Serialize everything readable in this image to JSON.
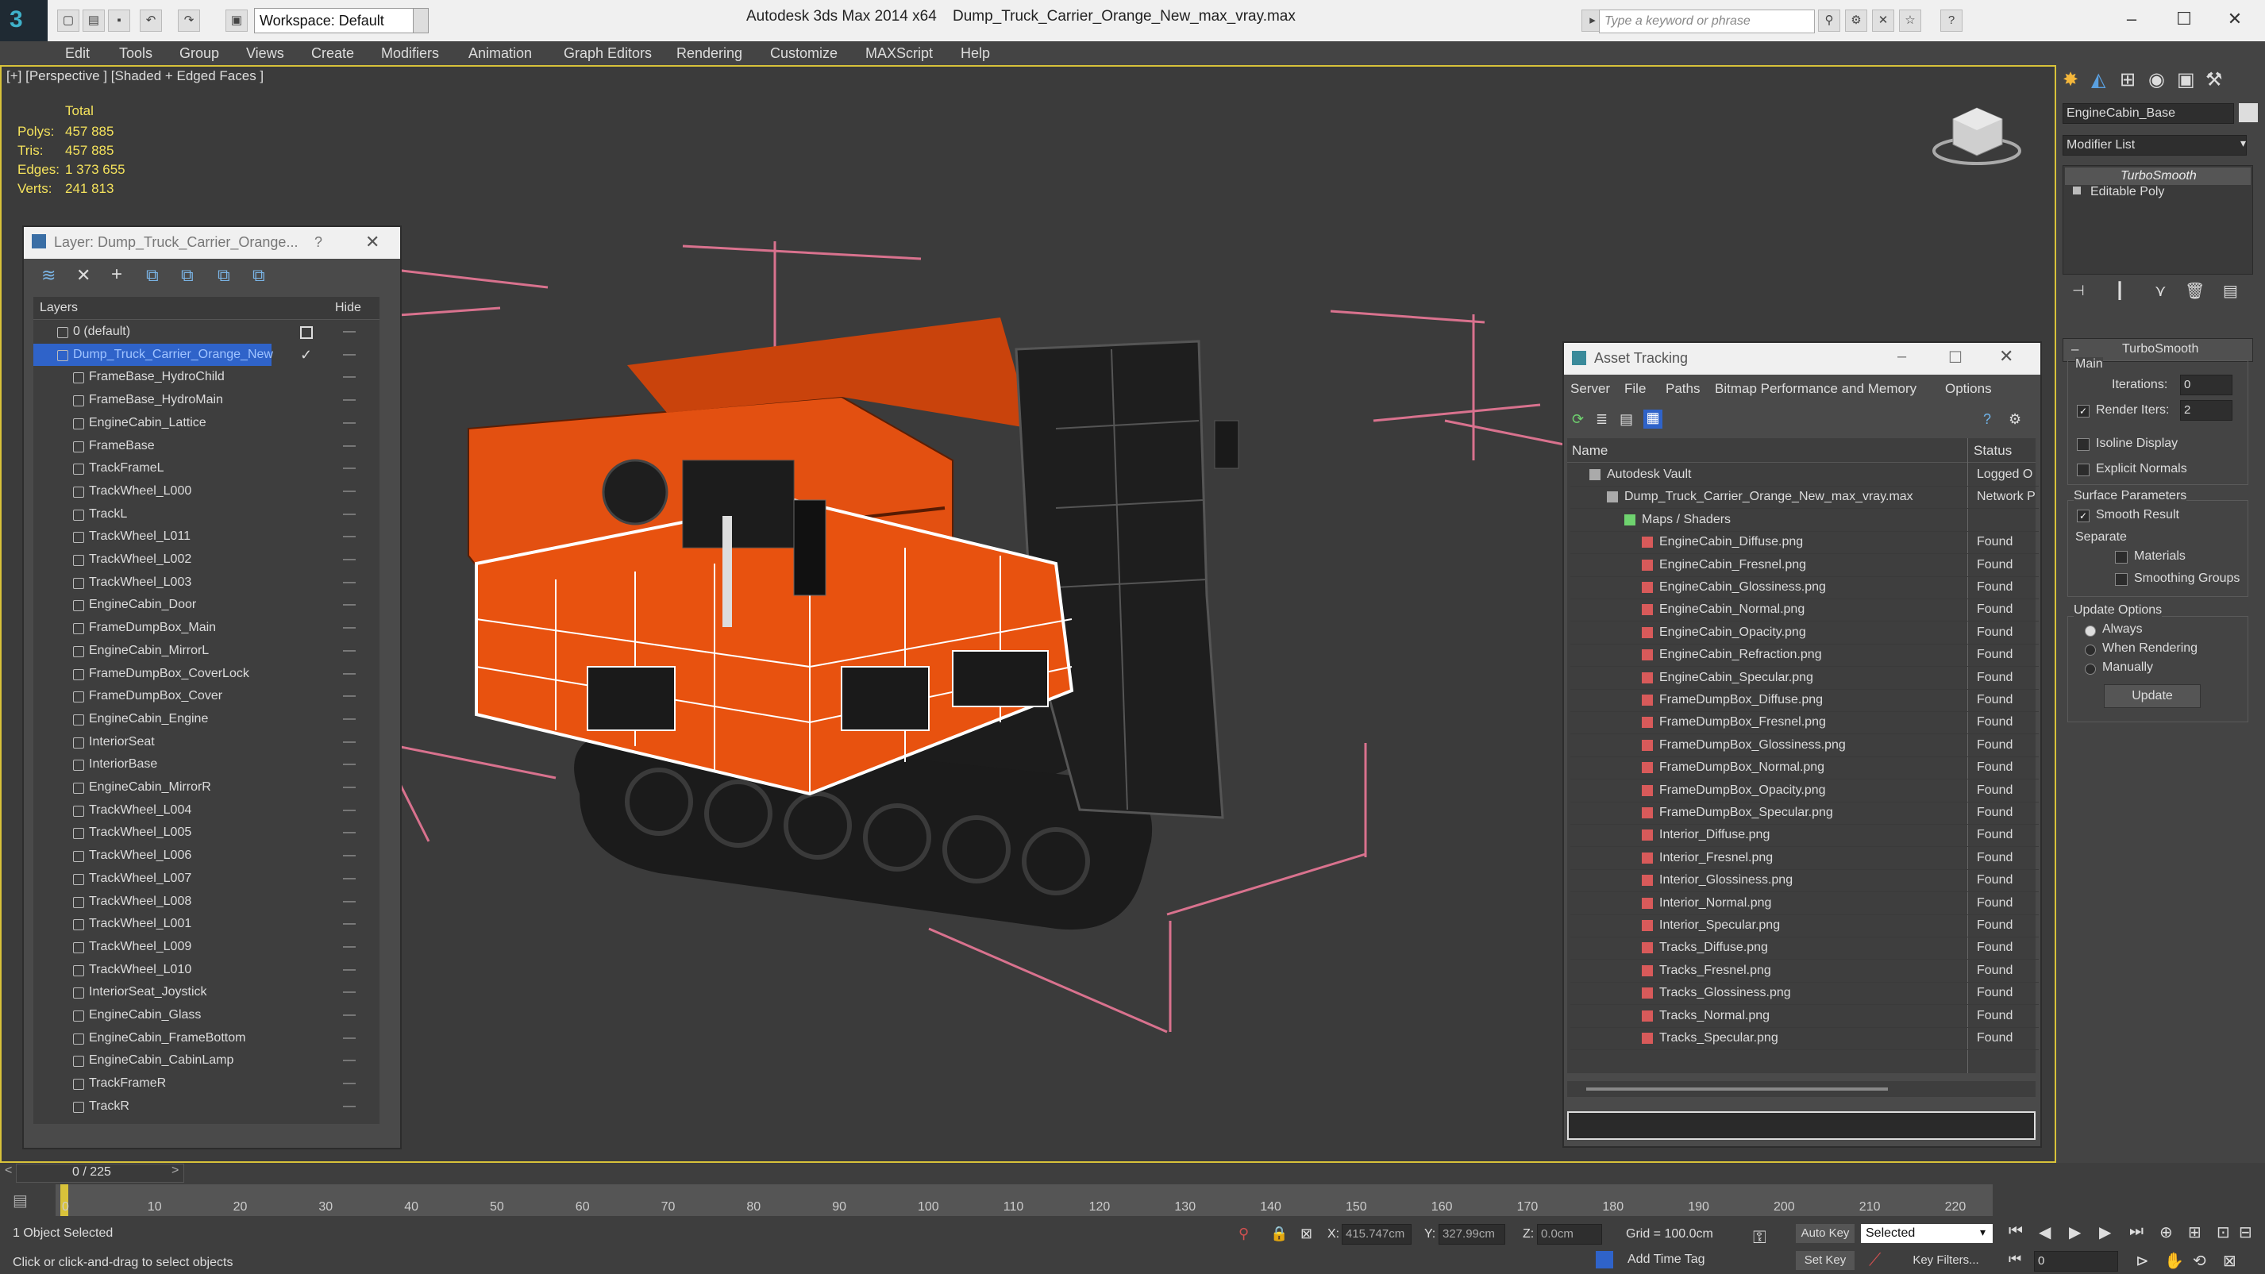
{
  "titlebar": {
    "workspace": "Workspace: Default",
    "app_title": "Autodesk 3ds Max  2014 x64",
    "file_title": "Dump_Truck_Carrier_Orange_New_max_vray.max",
    "search_placeholder": "Type a keyword or phrase"
  },
  "menu": [
    "Edit",
    "Tools",
    "Group",
    "Views",
    "Create",
    "Modifiers",
    "Animation",
    "Graph Editors",
    "Rendering",
    "Customize",
    "MAXScript",
    "Help"
  ],
  "viewport": {
    "label": "[+] [Perspective ] [Shaded + Edged Faces ]",
    "stats": {
      "header": "Total",
      "labels": [
        "Polys:",
        "Tris:",
        "Edges:",
        "Verts:"
      ],
      "values": [
        "457 885",
        "457 885",
        "1 373 655",
        "241 813"
      ]
    }
  },
  "layer_window": {
    "title": "Layer: Dump_Truck_Carrier_Orange...",
    "help": "?",
    "col_layers": "Layers",
    "col_hide": "Hide",
    "rows": [
      "0 (default)",
      "Dump_Truck_Carrier_Orange_New",
      "FrameBase_HydroChild",
      "FrameBase_HydroMain",
      "EngineCabin_Lattice",
      "FrameBase",
      "TrackFrameL",
      "TrackWheel_L000",
      "TrackL",
      "TrackWheel_L011",
      "TrackWheel_L002",
      "TrackWheel_L003",
      "EngineCabin_Door",
      "FrameDumpBox_Main",
      "EngineCabin_MirrorL",
      "FrameDumpBox_CoverLock",
      "FrameDumpBox_Cover",
      "EngineCabin_Engine",
      "InteriorSeat",
      "InteriorBase",
      "EngineCabin_MirrorR",
      "TrackWheel_L004",
      "TrackWheel_L005",
      "TrackWheel_L006",
      "TrackWheel_L007",
      "TrackWheel_L008",
      "TrackWheel_L001",
      "TrackWheel_L009",
      "TrackWheel_L010",
      "InteriorSeat_Joystick",
      "EngineCabin_Glass",
      "EngineCabin_FrameBottom",
      "EngineCabin_CabinLamp",
      "TrackFrameR",
      "TrackR"
    ]
  },
  "asset_window": {
    "title": "Asset Tracking",
    "menu": [
      "Server",
      "File",
      "Paths",
      "Bitmap Performance and Memory",
      "Options"
    ],
    "col_name": "Name",
    "col_status": "Status",
    "rows": [
      {
        "name": "Autodesk Vault",
        "status": "Logged O",
        "indent": 1
      },
      {
        "name": "Dump_Truck_Carrier_Orange_New_max_vray.max",
        "status": "Network P",
        "indent": 2
      },
      {
        "name": "Maps / Shaders",
        "status": "",
        "indent": 3
      },
      {
        "name": "EngineCabin_Diffuse.png",
        "status": "Found",
        "indent": 4
      },
      {
        "name": "EngineCabin_Fresnel.png",
        "status": "Found",
        "indent": 4
      },
      {
        "name": "EngineCabin_Glossiness.png",
        "status": "Found",
        "indent": 4
      },
      {
        "name": "EngineCabin_Normal.png",
        "status": "Found",
        "indent": 4
      },
      {
        "name": "EngineCabin_Opacity.png",
        "status": "Found",
        "indent": 4
      },
      {
        "name": "EngineCabin_Refraction.png",
        "status": "Found",
        "indent": 4
      },
      {
        "name": "EngineCabin_Specular.png",
        "status": "Found",
        "indent": 4
      },
      {
        "name": "FrameDumpBox_Diffuse.png",
        "status": "Found",
        "indent": 4
      },
      {
        "name": "FrameDumpBox_Fresnel.png",
        "status": "Found",
        "indent": 4
      },
      {
        "name": "FrameDumpBox_Glossiness.png",
        "status": "Found",
        "indent": 4
      },
      {
        "name": "FrameDumpBox_Normal.png",
        "status": "Found",
        "indent": 4
      },
      {
        "name": "FrameDumpBox_Opacity.png",
        "status": "Found",
        "indent": 4
      },
      {
        "name": "FrameDumpBox_Specular.png",
        "status": "Found",
        "indent": 4
      },
      {
        "name": "Interior_Diffuse.png",
        "status": "Found",
        "indent": 4
      },
      {
        "name": "Interior_Fresnel.png",
        "status": "Found",
        "indent": 4
      },
      {
        "name": "Interior_Glossiness.png",
        "status": "Found",
        "indent": 4
      },
      {
        "name": "Interior_Normal.png",
        "status": "Found",
        "indent": 4
      },
      {
        "name": "Interior_Specular.png",
        "status": "Found",
        "indent": 4
      },
      {
        "name": "Tracks_Diffuse.png",
        "status": "Found",
        "indent": 4
      },
      {
        "name": "Tracks_Fresnel.png",
        "status": "Found",
        "indent": 4
      },
      {
        "name": "Tracks_Glossiness.png",
        "status": "Found",
        "indent": 4
      },
      {
        "name": "Tracks_Normal.png",
        "status": "Found",
        "indent": 4
      },
      {
        "name": "Tracks_Specular.png",
        "status": "Found",
        "indent": 4
      }
    ]
  },
  "command_panel": {
    "object_name": "EngineCabin_Base",
    "modifier_list": "Modifier List",
    "stack": [
      "TurboSmooth",
      "Editable Poly"
    ],
    "rollout_title": "TurboSmooth",
    "main_label": "Main",
    "iterations_label": "Iterations:",
    "iterations_value": "0",
    "render_iters_label": "Render Iters:",
    "render_iters_value": "2",
    "isoline": "Isoline Display",
    "explicit_normals": "Explicit Normals",
    "surface_params": "Surface Parameters",
    "smooth_result": "Smooth Result",
    "separate": "Separate",
    "materials": "Materials",
    "smoothing_groups": "Smoothing Groups",
    "update_options": "Update Options",
    "always": "Always",
    "when_rendering": "When Rendering",
    "manually": "Manually",
    "update_button": "Update"
  },
  "timeline": {
    "frame": "0 / 225",
    "ticks": [
      "0",
      "10",
      "20",
      "30",
      "40",
      "50",
      "60",
      "70",
      "80",
      "90",
      "100",
      "110",
      "120",
      "130",
      "140",
      "150",
      "160",
      "170",
      "180",
      "190",
      "200",
      "210",
      "220"
    ]
  },
  "status": {
    "selected": "1 Object Selected",
    "hint": "Click or click-and-drag to select objects",
    "x_label": "X:",
    "x_value": "415.747cm",
    "y_label": "Y:",
    "y_value": "327.99cm",
    "z_label": "Z:",
    "z_value": "0.0cm",
    "grid": "Grid = 100.0cm",
    "auto_key": "Auto Key",
    "selected_dropdown": "Selected",
    "set_key": "Set Key",
    "key_filters": "Key Filters...",
    "add_time_tag": "Add Time Tag",
    "frame_field": "0"
  },
  "colors": {
    "accent": "#d8c23a",
    "selection": "#2f63c9",
    "truck": "#e8520f",
    "stats": "#f4e25c"
  }
}
